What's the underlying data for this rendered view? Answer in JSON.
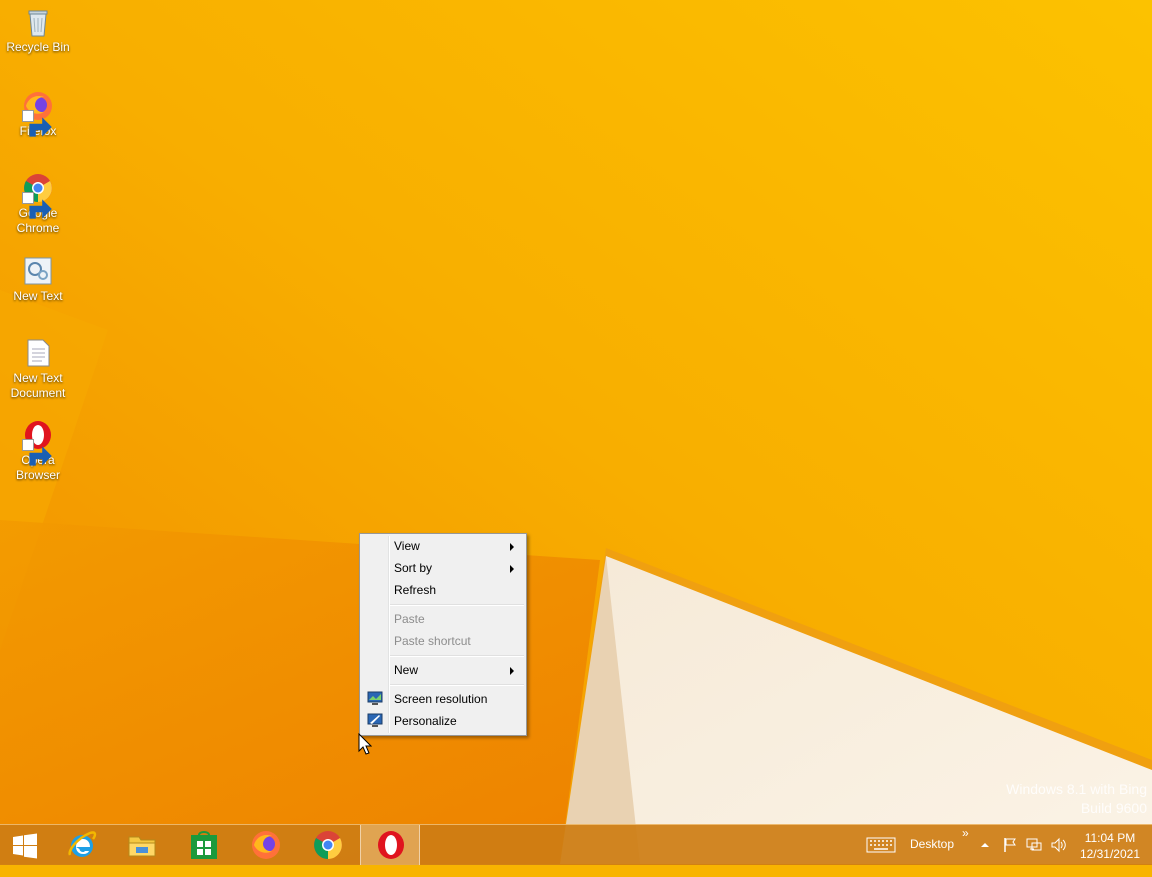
{
  "desktop": {
    "icons": [
      {
        "label": "Recycle Bin",
        "icon": "recycle-bin-icon"
      },
      {
        "label": "Firefox",
        "icon": "firefox-icon"
      },
      {
        "label": "Google Chrome",
        "icon": "chrome-icon"
      },
      {
        "label": "New Text",
        "icon": "control-panel-icon"
      },
      {
        "label": "New Text Document",
        "icon": "text-document-icon"
      },
      {
        "label": "Opera Browser",
        "icon": "opera-icon"
      }
    ]
  },
  "context_menu": {
    "view": "View",
    "sort_by": "Sort by",
    "refresh": "Refresh",
    "paste": "Paste",
    "paste_shortcut": "Paste shortcut",
    "new": "New",
    "screen_resolution": "Screen resolution",
    "personalize": "Personalize"
  },
  "watermark": {
    "line1": "Windows 8.1 with Bing",
    "line2": "Build 9600"
  },
  "taskbar": {
    "apps": [
      "internet-explorer-icon",
      "file-explorer-icon",
      "store-icon",
      "firefox-icon",
      "chrome-icon",
      "opera-icon"
    ],
    "desktop_toolbar": "Desktop",
    "chevron": "»",
    "time": "11:04 PM",
    "date": "12/31/2021"
  },
  "colors": {
    "wallpaper_main": "#f8b400",
    "wallpaper_dark": "#f08a00",
    "taskbar": "#cd7d14"
  }
}
